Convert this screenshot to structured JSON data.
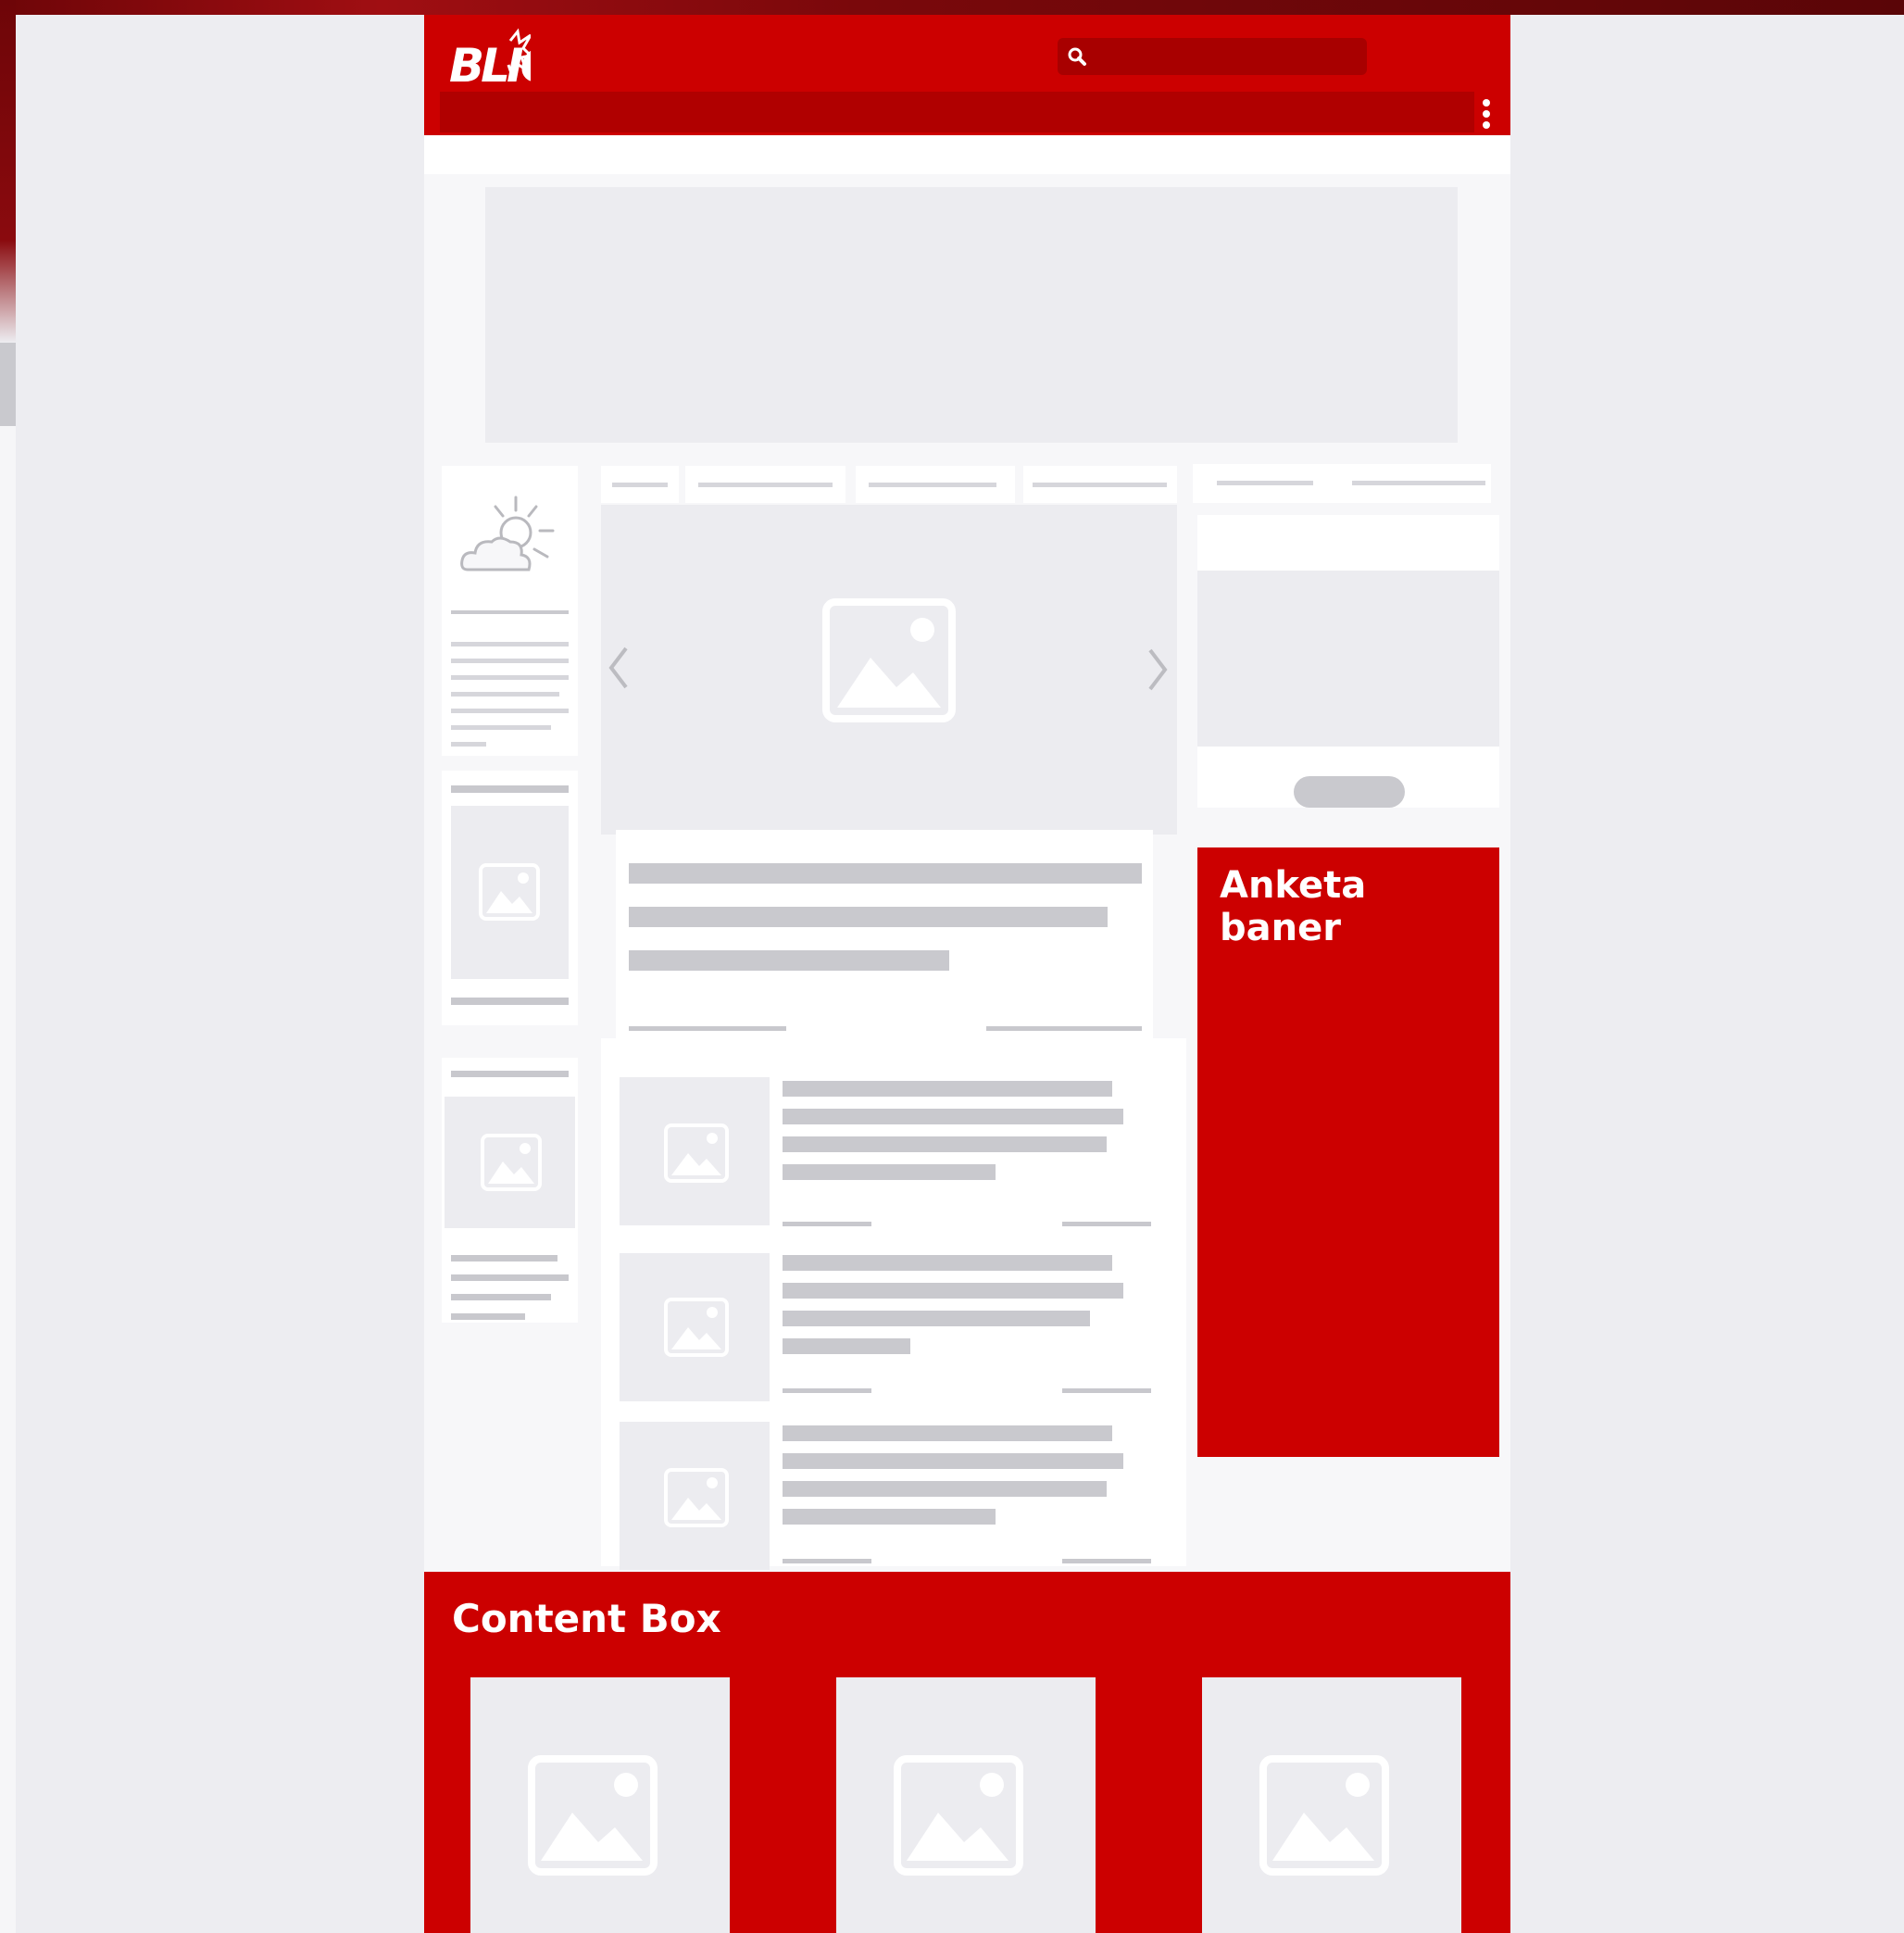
{
  "brand": {
    "logo_text": "BLIC",
    "accent_color": "#cc0000",
    "dark_accent": "#b00000"
  },
  "header": {
    "search_icon": "search-icon",
    "menu_icon": "kebab-menu-icon"
  },
  "weather_widget": {
    "icon": "sun-cloud-icon"
  },
  "slider": {
    "prev_icon": "chevron-left-icon",
    "next_icon": "chevron-right-icon"
  },
  "anketa": {
    "title": "Anketa baner"
  },
  "content_box": {
    "title": "Content Box",
    "cards": 3
  }
}
